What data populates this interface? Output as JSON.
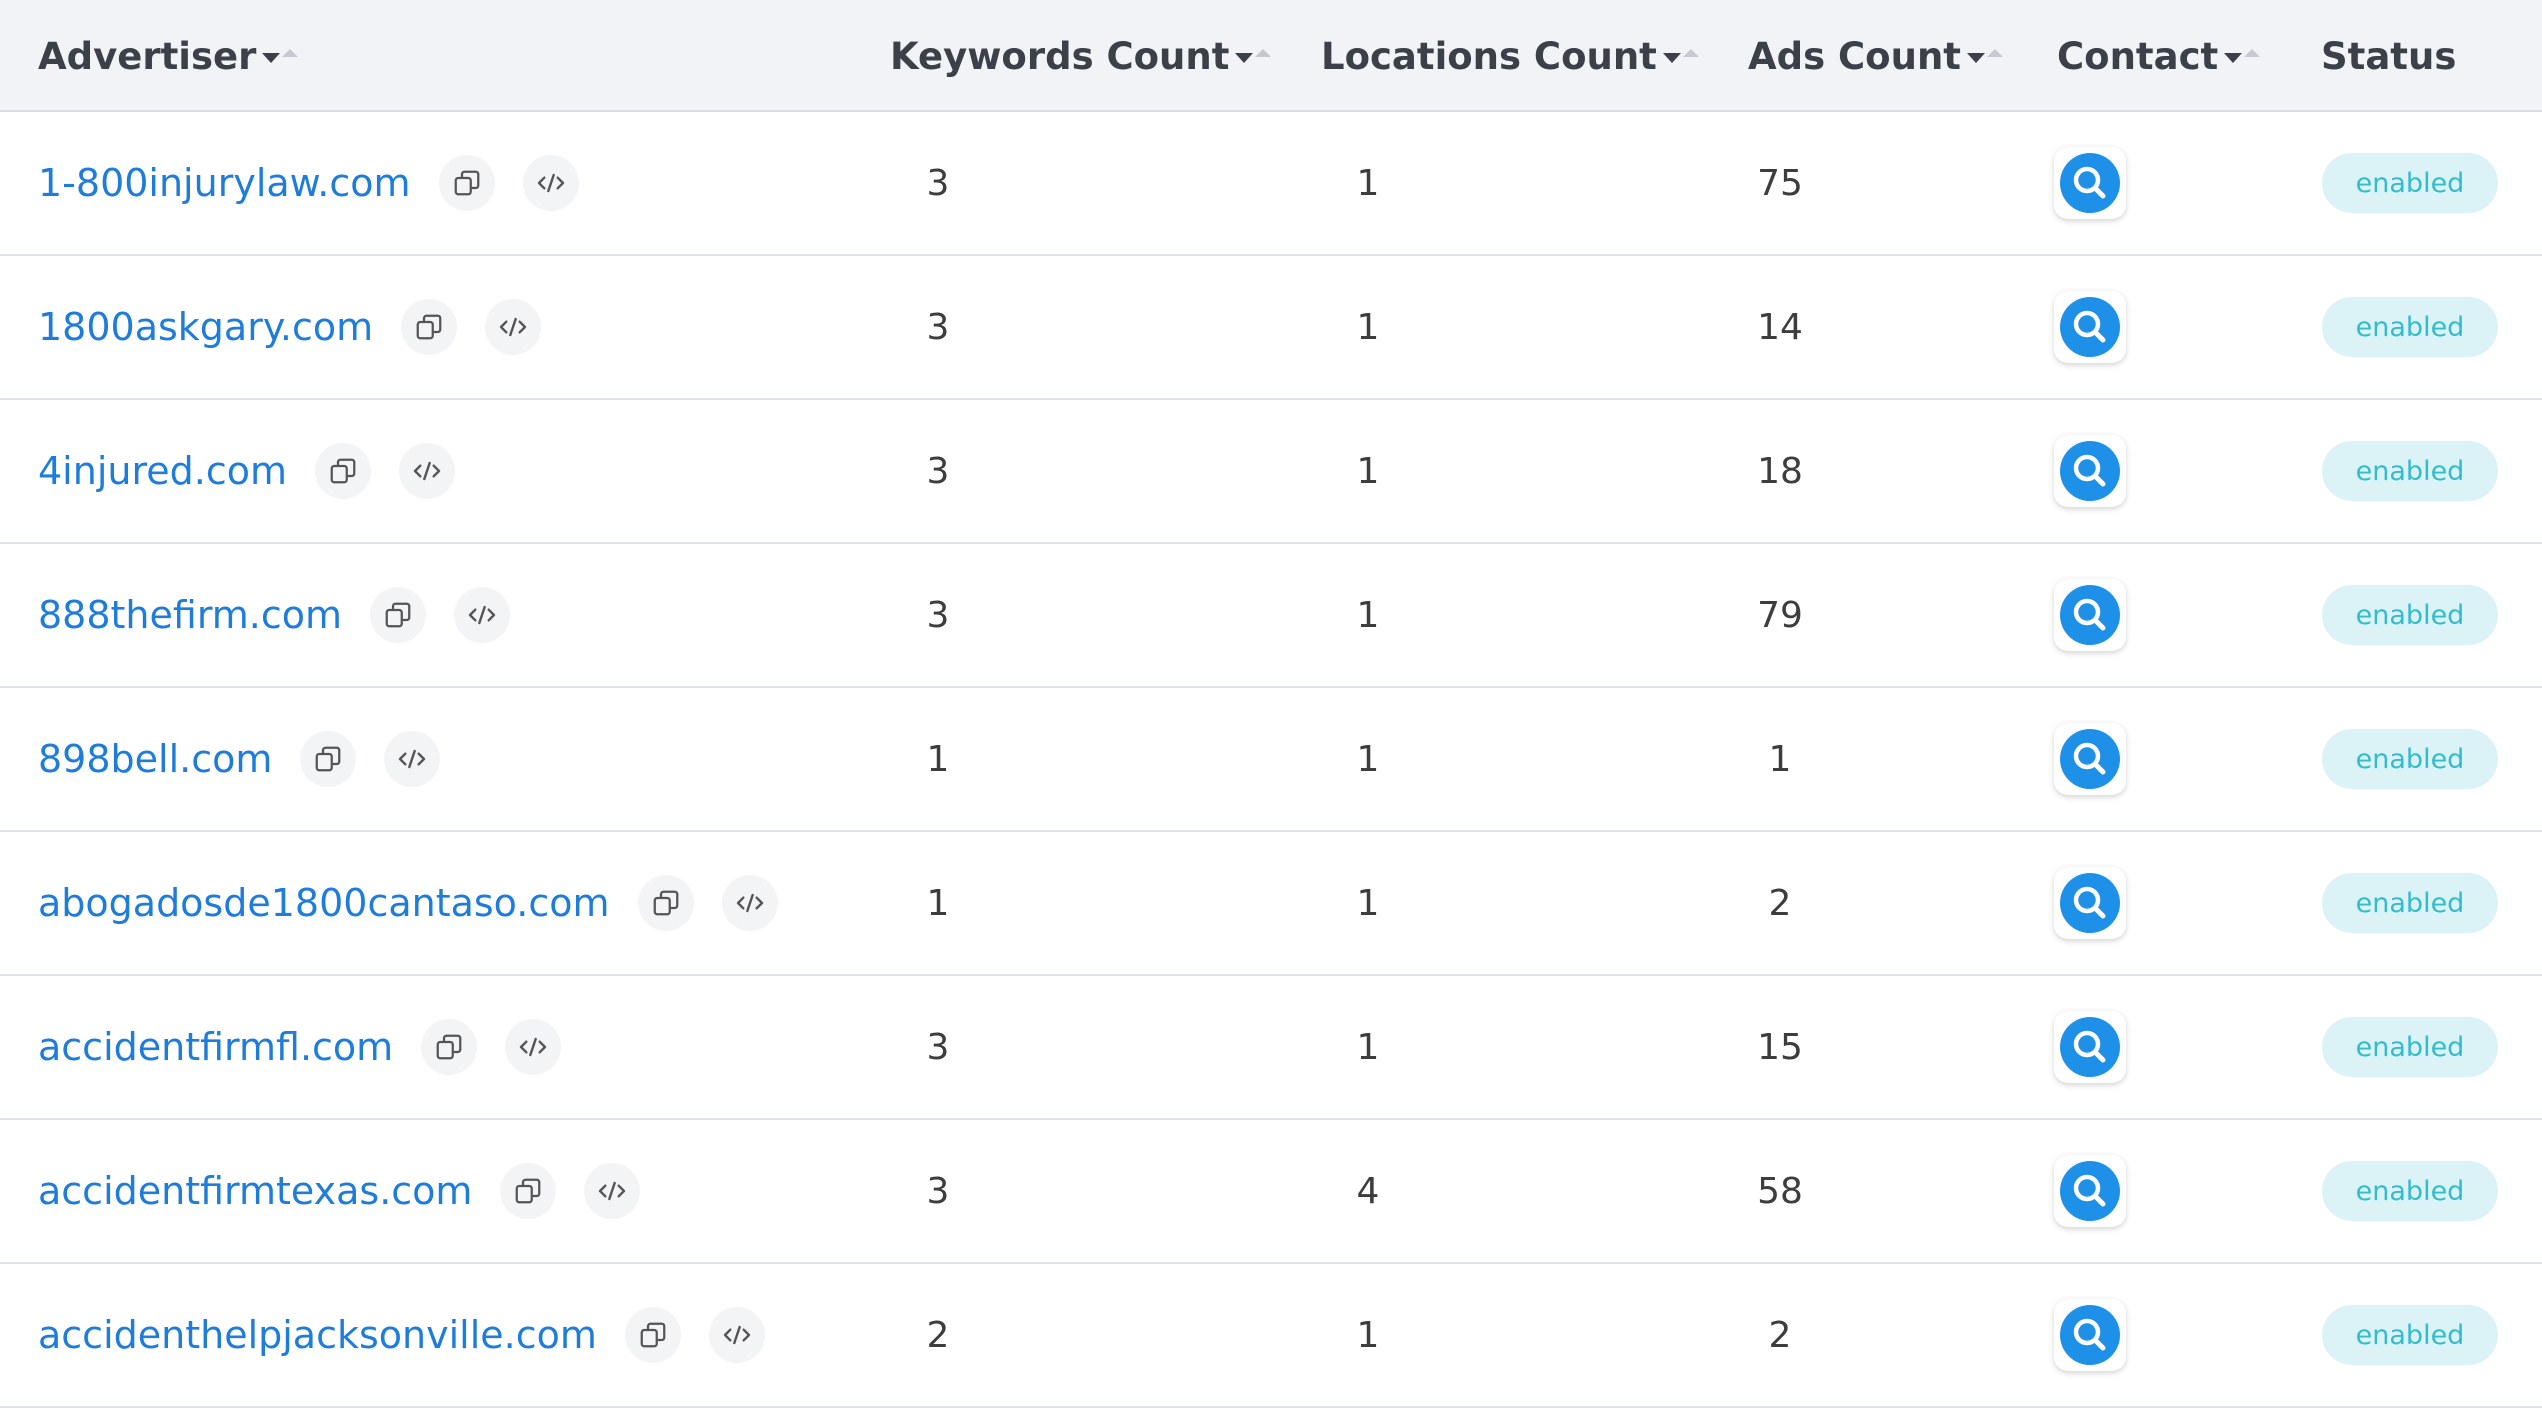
{
  "table": {
    "columns": [
      {
        "key": "advertiser",
        "label": "Advertiser",
        "sortable": true
      },
      {
        "key": "keywords",
        "label": "Keywords Count",
        "sortable": true
      },
      {
        "key": "locations",
        "label": "Locations Count",
        "sortable": true
      },
      {
        "key": "ads",
        "label": "Ads Count",
        "sortable": true
      },
      {
        "key": "contact",
        "label": "Contact",
        "sortable": true
      },
      {
        "key": "status",
        "label": "Status",
        "sortable": false
      }
    ],
    "rows": [
      {
        "advertiser": "1-800injurylaw.com",
        "keywords": "3",
        "locations": "1",
        "ads": "75",
        "status": "enabled"
      },
      {
        "advertiser": "1800askgary.com",
        "keywords": "3",
        "locations": "1",
        "ads": "14",
        "status": "enabled"
      },
      {
        "advertiser": "4injured.com",
        "keywords": "3",
        "locations": "1",
        "ads": "18",
        "status": "enabled"
      },
      {
        "advertiser": "888thefirm.com",
        "keywords": "3",
        "locations": "1",
        "ads": "79",
        "status": "enabled"
      },
      {
        "advertiser": "898bell.com",
        "keywords": "1",
        "locations": "1",
        "ads": "1",
        "status": "enabled"
      },
      {
        "advertiser": "abogadosde1800cantaso.com",
        "keywords": "1",
        "locations": "1",
        "ads": "2",
        "status": "enabled"
      },
      {
        "advertiser": "accidentfirmfl.com",
        "keywords": "3",
        "locations": "1",
        "ads": "15",
        "status": "enabled"
      },
      {
        "advertiser": "accidentfirmtexas.com",
        "keywords": "3",
        "locations": "4",
        "ads": "58",
        "status": "enabled"
      },
      {
        "advertiser": "accidenthelpjacksonville.com",
        "keywords": "2",
        "locations": "1",
        "ads": "2",
        "status": "enabled"
      }
    ]
  },
  "icons": {
    "copy": "copy-icon",
    "embed": "code-icon",
    "contact": "search-icon"
  },
  "colors": {
    "link": "#1e7ddb",
    "header_bg": "#f1f3f7",
    "contact_icon": "#1e90e8",
    "badge_bg": "#dbf3f6",
    "badge_text": "#33bccc"
  }
}
